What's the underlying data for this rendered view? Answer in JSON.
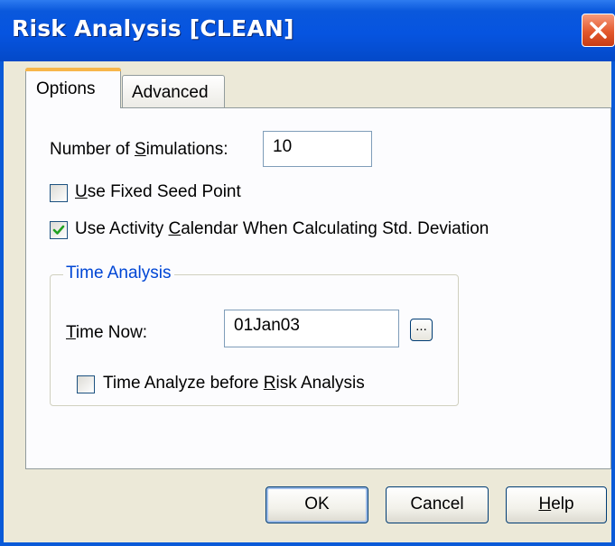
{
  "window": {
    "title": "Risk Analysis [CLEAN]",
    "close_icon": "close-icon"
  },
  "tabs": [
    {
      "label": "Options",
      "active": true
    },
    {
      "label": "Advanced",
      "active": false
    }
  ],
  "options": {
    "simulations_label_pre": "Number of ",
    "simulations_label_key": "S",
    "simulations_label_post": "imulations:",
    "simulations_value": "10",
    "fixed_seed": {
      "key": "U",
      "rest": "se Fixed Seed Point",
      "checked": false
    },
    "activity_calendar": {
      "pre": "Use Activity ",
      "key": "C",
      "post": "alendar When Calculating Std. Deviation",
      "checked": true
    }
  },
  "time_analysis": {
    "group_title": "Time Analysis",
    "time_now_key": "T",
    "time_now_rest": "ime Now:",
    "time_now_value": "01Jan03",
    "browse_label": "...",
    "before_risk": {
      "pre": "Time Analyze before ",
      "key": "R",
      "post": "isk Analysis",
      "checked": false
    }
  },
  "buttons": {
    "ok": "OK",
    "cancel": "Cancel",
    "help_key": "H",
    "help_rest": "elp"
  },
  "colors": {
    "titlebar": "#0654e0",
    "dialog_bg": "#ece9d8",
    "panel_bg": "#fcfcfe",
    "group_title": "#0046d5",
    "active_tab_highlight": "#f7b64b",
    "check_mark": "#21a121"
  }
}
